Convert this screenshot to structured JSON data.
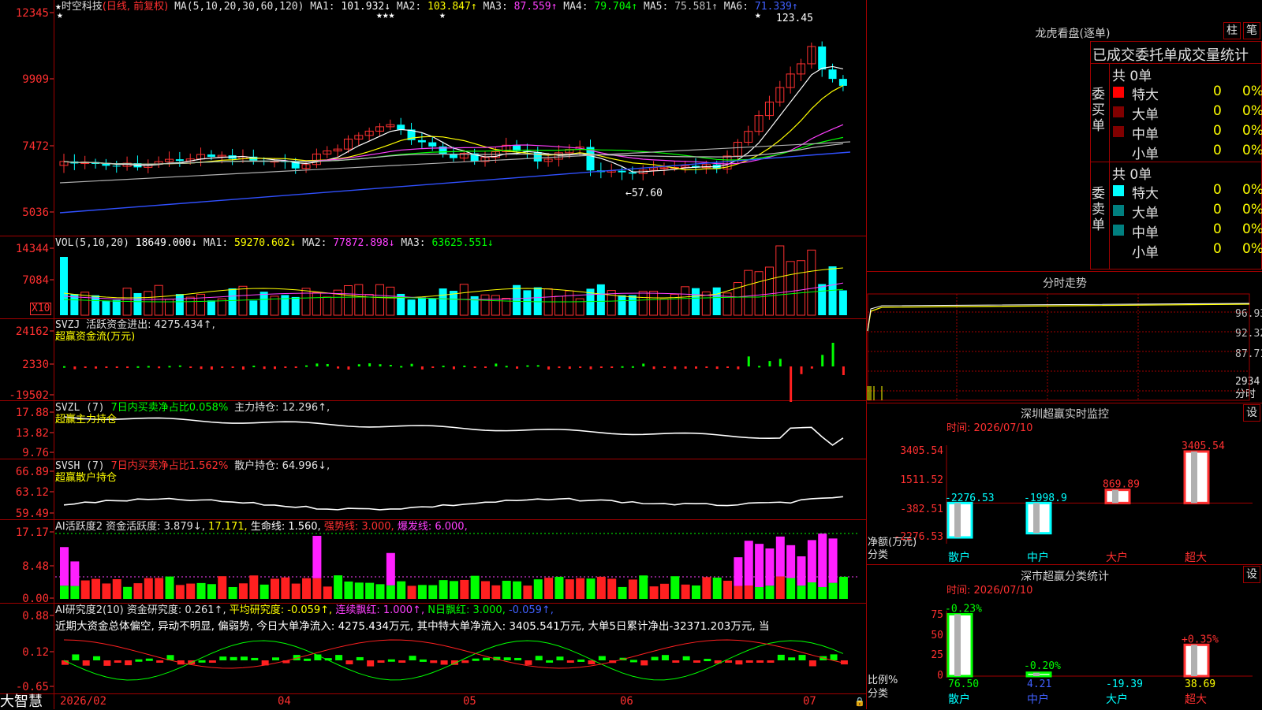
{
  "app": {
    "brand": "大智慧"
  },
  "main_chart": {
    "header_star": "★",
    "stock": "时空科技",
    "mode": "(日线, 前复权)",
    "ma_head": "MA(5,10,20,30,60,120)",
    "ma": [
      {
        "k": "MA1:",
        "v": "101.932↓",
        "c": "#ffffff"
      },
      {
        "k": "MA2:",
        "v": "103.847↑",
        "c": "#ffff00"
      },
      {
        "k": "MA3:",
        "v": "87.559↑",
        "c": "#ff40ff"
      },
      {
        "k": "MA4:",
        "v": "79.704↑",
        "c": "#00ff00"
      },
      {
        "k": "MA5:",
        "v": "75.581↑",
        "c": "#c0c0c0"
      },
      {
        "k": "MA6:",
        "v": "71.339↑",
        "c": "#4060ff"
      }
    ],
    "y_ticks": [
      "12345",
      "9909",
      "7472",
      "5036"
    ],
    "high_label": "123.45",
    "low_label": "←57.60",
    "dates": [
      "2026/02",
      "04",
      "05",
      "06",
      "07"
    ],
    "star_marks": [
      "★",
      "★★★",
      "★",
      "★"
    ]
  },
  "vol": {
    "head": "VOL(5,10,20)",
    "val": "18649.000↓",
    "ma": [
      {
        "k": "MA1:",
        "v": "59270.602↓",
        "c": "#ffff00"
      },
      {
        "k": "MA2:",
        "v": "77872.898↓",
        "c": "#ff40ff"
      },
      {
        "k": "MA3:",
        "v": "63625.551↓",
        "c": "#00ff00"
      }
    ],
    "y_ticks": [
      "14344",
      "7084"
    ],
    "unit": "X10"
  },
  "svzj": {
    "head": "SVZJ",
    "label": "活跃资金进出: 4275.434↑,",
    "sub": "超赢资金流(万元)",
    "y_ticks": [
      "24162",
      "2330",
      "-19502"
    ]
  },
  "svzl": {
    "head": "SVZL (7)",
    "a": "7日内买卖净占比0.058%",
    "b": "主力持仓: 12.296↑,",
    "sub": "超赢主力持仓",
    "y_ticks": [
      "17.88",
      "13.82",
      "9.76"
    ]
  },
  "svsh": {
    "head": "SVSH (7)",
    "a": "7日内买卖净占比1.562%",
    "b": "散户持仓: 64.996↓,",
    "sub": "超赢散户持仓",
    "y_ticks": [
      "66.89",
      "63.12",
      "59.49"
    ]
  },
  "ai1": {
    "head": "AI活跃度2",
    "a": "资金活跃度: 3.879↓,",
    "b": "17.171,",
    "c": "生命线: 1.560,",
    "d": "强势线: 3.000,",
    "e": "爆发线: 6.000,",
    "y_ticks": [
      "17.17",
      "8.48",
      "0.00"
    ]
  },
  "ai2": {
    "head": "AI研究度2(10)",
    "a": "资金研究度: 0.261↑,",
    "b": "平均研究度: -0.059↑,",
    "c": "连续飘红: 1.000↑,",
    "d": "N日飘红: 3.000,",
    "e": "-0.059↑,",
    "note": "近期大资金总体偏空, 异动不明显, 偏弱势, 今日大单净流入: 4275.434万元, 其中特大单净流入: 3405.541万元, 大单5日累计净出-32371.203万元, 当",
    "y_ticks": [
      "0.88",
      "0.12",
      "-0.65"
    ]
  },
  "lhkp": {
    "title": "龙虎看盘(逐单)",
    "btn1": "柱",
    "btn2": "笔",
    "tabs": "已成交委托单成交量统计",
    "buy_label": "委买单",
    "sell_label": "委卖单",
    "total": "共 0单",
    "rows": [
      {
        "n": "特大",
        "v": "0",
        "p": "0%"
      },
      {
        "n": "大单",
        "v": "0",
        "p": "0%"
      },
      {
        "n": "中单",
        "v": "0",
        "p": "0%"
      },
      {
        "n": "小单",
        "v": "0",
        "p": "0%"
      }
    ]
  },
  "fenshi": {
    "title": "分时走势",
    "y": [
      "96.93",
      "92.32",
      "87.71",
      "2934"
    ],
    "unit": "分时"
  },
  "szjk": {
    "title": "深圳超赢实时监控",
    "btn": "设",
    "time": "时间: 2026/07/10",
    "y": [
      "3405.54",
      "1511.52",
      "-382.51",
      "-2276.53"
    ],
    "ylabel": "净额(万元)",
    "xlabel": "分类",
    "bars": [
      {
        "cat": "散户",
        "val": "-2276.53"
      },
      {
        "cat": "中户",
        "val": "-1998.9"
      },
      {
        "cat": "大户",
        "val": "869.89"
      },
      {
        "cat": "超大",
        "val": "3405.54"
      }
    ]
  },
  "szfl": {
    "title": "深市超赢分类统计",
    "btn": "设",
    "time": "时间: 2026/07/10",
    "y": [
      "75",
      "50",
      "25",
      "0"
    ],
    "ylabel": "比例%",
    "xlabel": "分类",
    "bars": [
      {
        "cat": "散户",
        "val": "76.50",
        "chg": "-0.23%"
      },
      {
        "cat": "中户",
        "val": "4.21",
        "chg": "-0.20%"
      },
      {
        "cat": "大户",
        "val": "-19.39",
        "chg": ""
      },
      {
        "cat": "超大",
        "val": "38.69",
        "chg": "+0.35%"
      }
    ]
  },
  "chart_data": [
    {
      "type": "bar",
      "title": "深圳超赢实时监控",
      "ylabel": "净额(万元)",
      "xlabel": "分类",
      "categories": [
        "散户",
        "中户",
        "大户",
        "超大"
      ],
      "values": [
        -2276.53,
        -1998.9,
        869.89,
        3405.54
      ],
      "ylim": [
        -2276.53,
        3405.54
      ]
    },
    {
      "type": "bar",
      "title": "深市超赢分类统计",
      "ylabel": "比例%",
      "xlabel": "分类",
      "categories": [
        "散户",
        "中户",
        "大户",
        "超大"
      ],
      "values": [
        76.5,
        4.21,
        -19.39,
        38.69
      ],
      "ylim": [
        0,
        75
      ]
    }
  ]
}
